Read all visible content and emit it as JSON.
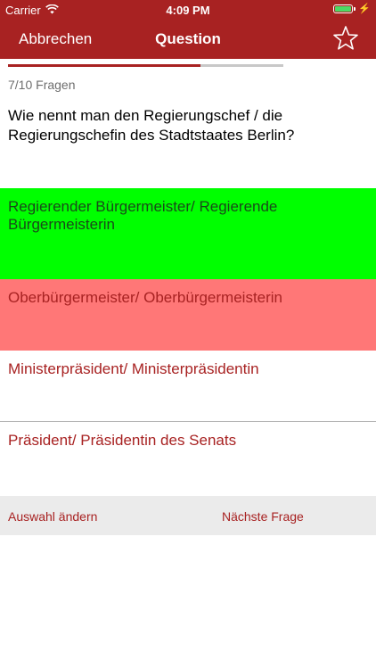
{
  "status_bar": {
    "carrier": "Carrier",
    "time": "4:09 PM",
    "battery_level": 1.0,
    "icons": [
      "wifi-icon",
      "battery-icon",
      "charging-bolt-icon"
    ]
  },
  "nav": {
    "cancel_label": "Abbrechen",
    "title": "Question",
    "favorite_icon": "star-outline-icon"
  },
  "progress": {
    "current": 7,
    "total": 10,
    "fraction": 0.7,
    "counter_text": "7/10 Fragen"
  },
  "question": {
    "text": "Wie nennt man den Regierungschef / die Regierungschefin des Stadtstaates Berlin?"
  },
  "answers": [
    {
      "label": "Regierender Bürgermeister/ Regierende Bürgermeisterin",
      "state": "correct"
    },
    {
      "label": "Oberbürgermeister/ Oberbürgermeisterin",
      "state": "wrong"
    },
    {
      "label": "Ministerpräsident/ Ministerpräsidentin",
      "state": "neutral"
    },
    {
      "label": "Präsident/ Präsidentin des Senats",
      "state": "neutral"
    }
  ],
  "footer": {
    "change_label": "Auswahl ändern",
    "next_label": "Nächste Frage"
  },
  "colors": {
    "brand": "#a82222",
    "correct": "#00ff00",
    "wrong": "#ff7777",
    "footer_bg": "#ebebeb"
  }
}
